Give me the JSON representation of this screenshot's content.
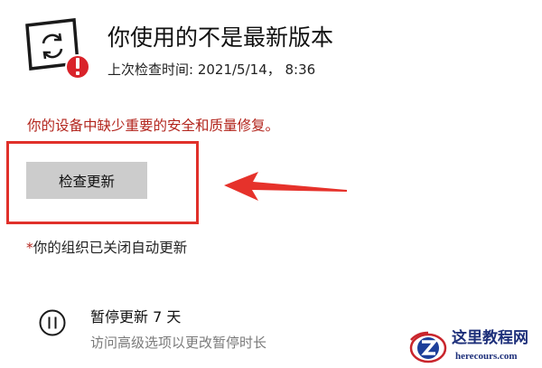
{
  "status": {
    "icon": "sync-warning-icon",
    "title": "你使用的不是最新版本",
    "last_check": "上次检查时间: 2021/5/14， 8:36"
  },
  "warning": {
    "text": "你的设备中缺少重要的安全和质量修复。",
    "color": "#b3261e"
  },
  "check_button": {
    "label": "检查更新"
  },
  "annotation": {
    "highlight_color": "#e0302a",
    "arrow_icon": "red-arrow-icon"
  },
  "org_note": {
    "asterisk": "*",
    "text": "你的组织已关闭自动更新"
  },
  "pause": {
    "icon": "pause-icon",
    "title": "暂停更新 7 天",
    "subtitle": "访问高级选项以更改暂停时长"
  },
  "watermark": {
    "name": "这里教程网",
    "url": "herecours.com",
    "logo_icon": "z-logo-icon"
  }
}
